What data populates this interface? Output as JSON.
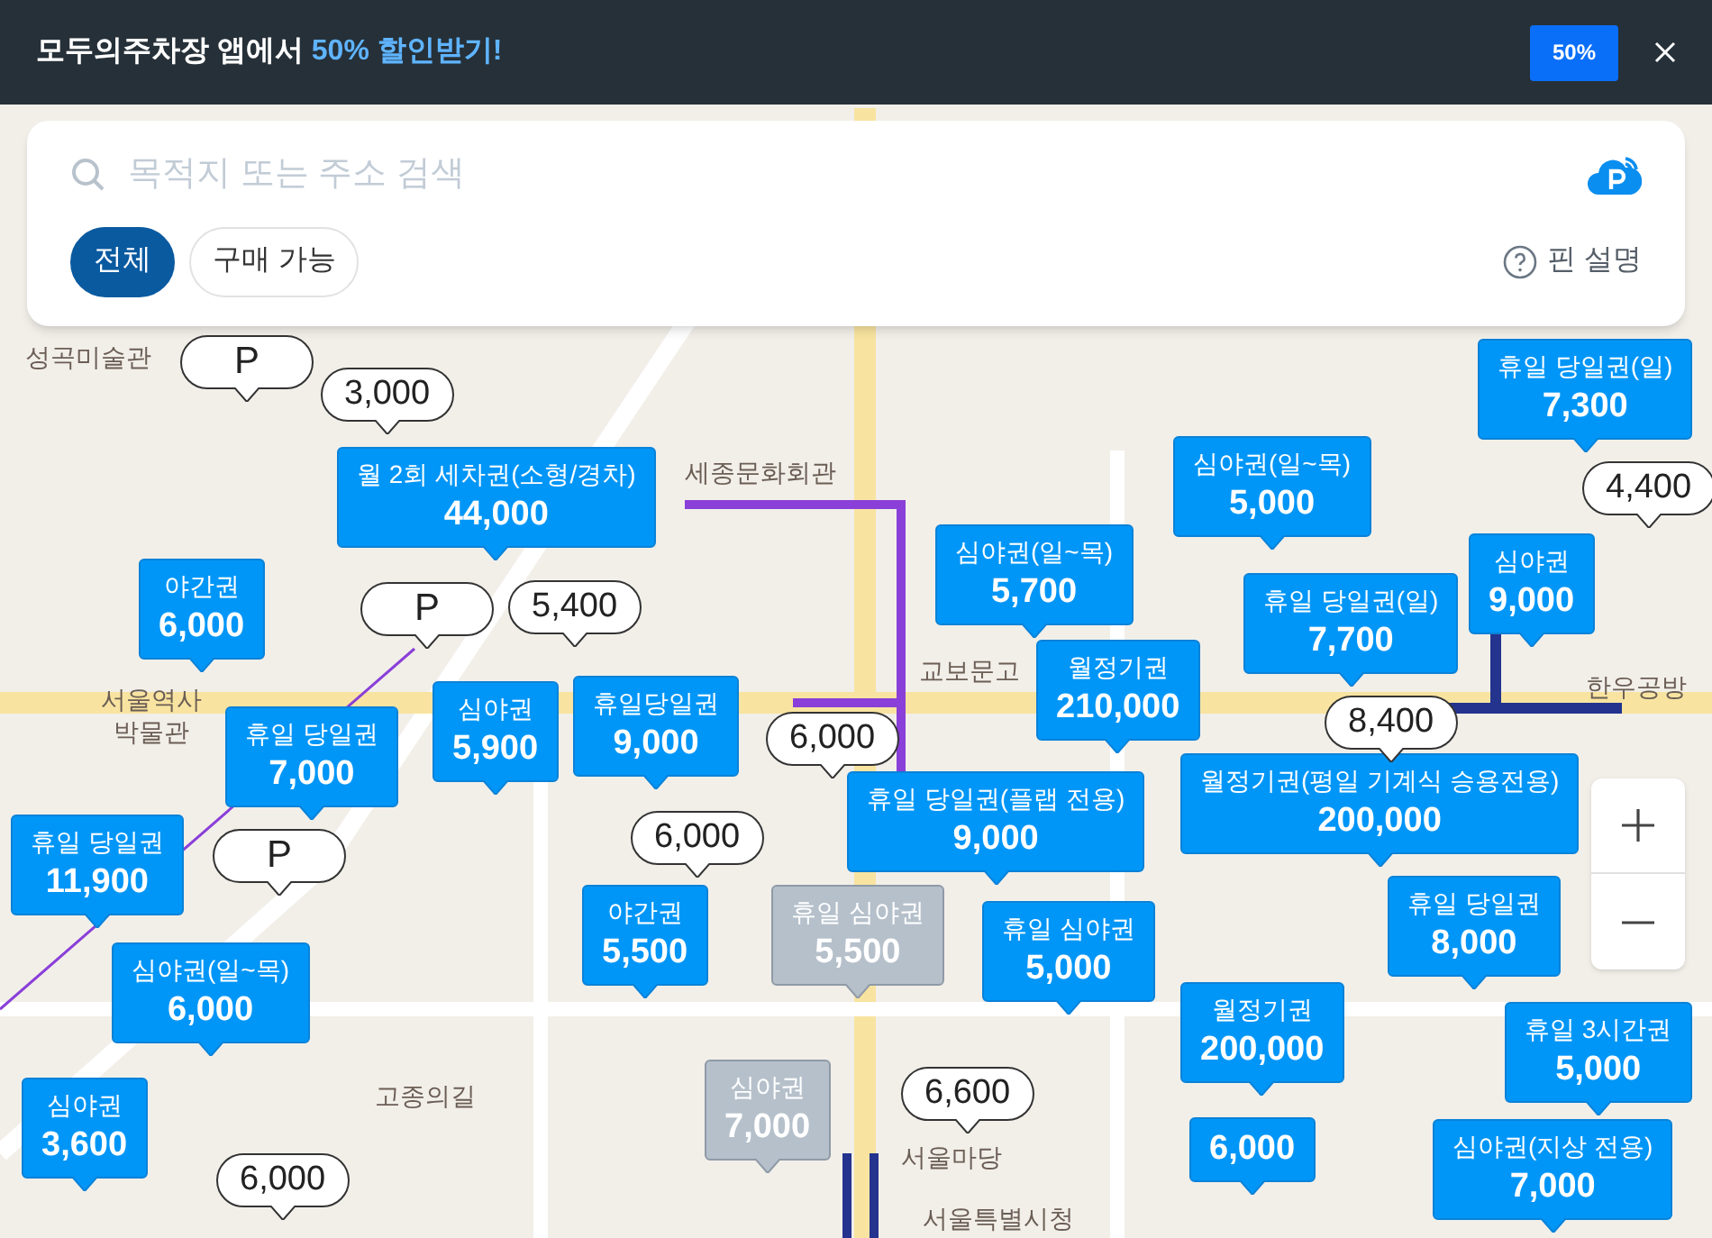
{
  "banner": {
    "text": "모두의주차장 앱에서",
    "highlight": "50% 할인받기!",
    "coupon": "50%"
  },
  "search": {
    "placeholder": "목적지 또는 주소 검색"
  },
  "filters": [
    {
      "label": "전체",
      "selected": true
    },
    {
      "label": "구매 가능",
      "selected": false
    }
  ],
  "pin_help": "핀 설명",
  "places": [
    "성곡미술관",
    "서울역사 박물관",
    "세종문화회관",
    "교보문고",
    "고종의길",
    "서울마당",
    "서울특별시청",
    "한우공방"
  ],
  "pins": [
    {
      "kind": "ticket",
      "label": "월 2회 세차권(소형/경차)",
      "price": "44,000",
      "available": true
    },
    {
      "kind": "ticket",
      "label": "야간권",
      "price": "6,000",
      "available": true
    },
    {
      "kind": "ticket",
      "label": "휴일 당일권",
      "price": "7,000",
      "available": true
    },
    {
      "kind": "ticket",
      "label": "심야권",
      "price": "5,900",
      "available": true
    },
    {
      "kind": "ticket",
      "label": "휴일당일권",
      "price": "9,000",
      "available": true
    },
    {
      "kind": "ticket",
      "label": "휴일 당일권",
      "price": "11,900",
      "available": true
    },
    {
      "kind": "ticket",
      "label": "심야권(일~목)",
      "price": "6,000",
      "available": true
    },
    {
      "kind": "ticket",
      "label": "심야권",
      "price": "3,600",
      "available": true
    },
    {
      "kind": "ticket",
      "label": "야간권",
      "price": "5,500",
      "available": true
    },
    {
      "kind": "ticket",
      "label": "휴일 심야권",
      "price": "5,500",
      "available": false
    },
    {
      "kind": "ticket",
      "label": "심야권",
      "price": "7,000",
      "available": false
    },
    {
      "kind": "ticket",
      "label": "심야권(일~목)",
      "price": "5,700",
      "available": true
    },
    {
      "kind": "ticket",
      "label": "심야권(일~목)",
      "price": "5,000",
      "available": true
    },
    {
      "kind": "ticket",
      "label": "휴일 당일권(일)",
      "price": "7,300",
      "available": true
    },
    {
      "kind": "ticket",
      "label": "휴일 당일권(일)",
      "price": "7,700",
      "available": true
    },
    {
      "kind": "ticket",
      "label": "심야권",
      "price": "9,000",
      "available": true
    },
    {
      "kind": "ticket",
      "label": "월정기권",
      "price": "210,000",
      "available": true
    },
    {
      "kind": "ticket",
      "label": "월정기권(평일 기계식 승용전용)",
      "price": "200,000",
      "available": true
    },
    {
      "kind": "ticket",
      "label": "휴일 당일권(플랩 전용)",
      "price": "9,000",
      "available": true
    },
    {
      "kind": "ticket",
      "label": "휴일 심야권",
      "price": "5,000",
      "available": true
    },
    {
      "kind": "ticket",
      "label": "휴일 당일권",
      "price": "8,000",
      "available": true
    },
    {
      "kind": "ticket",
      "label": "월정기권",
      "price": "200,000",
      "available": true
    },
    {
      "kind": "ticket",
      "label": "휴일 3시간권",
      "price": "5,000",
      "available": true
    },
    {
      "kind": "ticket",
      "price": "6,000",
      "available": true
    },
    {
      "kind": "ticket",
      "label": "심야권(지상 전용)",
      "price": "7,000",
      "available": true
    },
    {
      "kind": "parking",
      "text": "P"
    },
    {
      "kind": "price",
      "price": "3,000"
    },
    {
      "kind": "parking",
      "text": "P"
    },
    {
      "kind": "price",
      "price": "5,400"
    },
    {
      "kind": "price",
      "price": "6,000"
    },
    {
      "kind": "price",
      "price": "6,000"
    },
    {
      "kind": "parking",
      "text": "P"
    },
    {
      "kind": "price",
      "price": "6,000"
    },
    {
      "kind": "price",
      "price": "8,400"
    },
    {
      "kind": "price",
      "price": "4,400"
    },
    {
      "kind": "price",
      "price": "6,600"
    }
  ]
}
